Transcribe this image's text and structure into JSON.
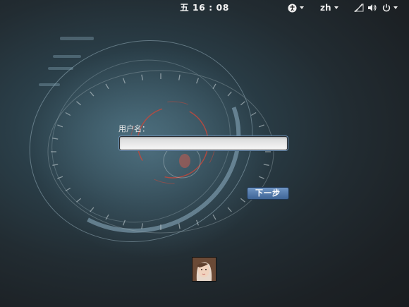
{
  "topbar": {
    "clock": "五 16 : 08",
    "language": "zh",
    "icons": [
      "accessibility-icon",
      "network-icon",
      "volume-icon",
      "power-icon"
    ]
  },
  "login": {
    "label": "用户名：",
    "username_value": "",
    "next_label": "下一步"
  },
  "colors": {
    "accent": "#3f6596",
    "input_focus": "#6f93b8",
    "dial_red": "#c0392b"
  }
}
